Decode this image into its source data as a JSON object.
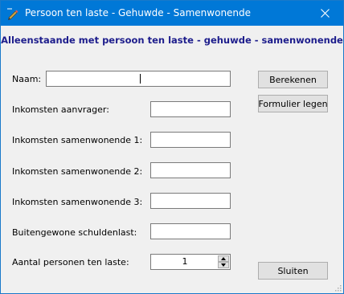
{
  "window": {
    "title": "Persoon ten laste - Gehuwde - Samenwonende"
  },
  "titlebar_icon": "pencil-app-icon",
  "heading": "Alleenstaande met persoon ten laste - gehuwde - samenwonende",
  "fields": {
    "naam": {
      "label": "Naam:",
      "value": ""
    },
    "inkomsten_aanvrager": {
      "label": "Inkomsten aanvrager:",
      "value": ""
    },
    "inkomsten_samenwonende_1": {
      "label": "Inkomsten samenwonende 1:",
      "value": ""
    },
    "inkomsten_samenwonende_2": {
      "label": "Inkomsten samenwonende 2:",
      "value": ""
    },
    "inkomsten_samenwonende_3": {
      "label": "Inkomsten samenwonende 3:",
      "value": ""
    },
    "buitengewone_schuldenlast": {
      "label": "Buitengewone schuldenlast:",
      "value": ""
    },
    "aantal_personen": {
      "label": "Aantal personen ten laste:",
      "value": "1"
    }
  },
  "buttons": {
    "berekenen": "Berekenen",
    "formulier_legen": "Formulier legen",
    "sluiten": "Sluiten"
  }
}
